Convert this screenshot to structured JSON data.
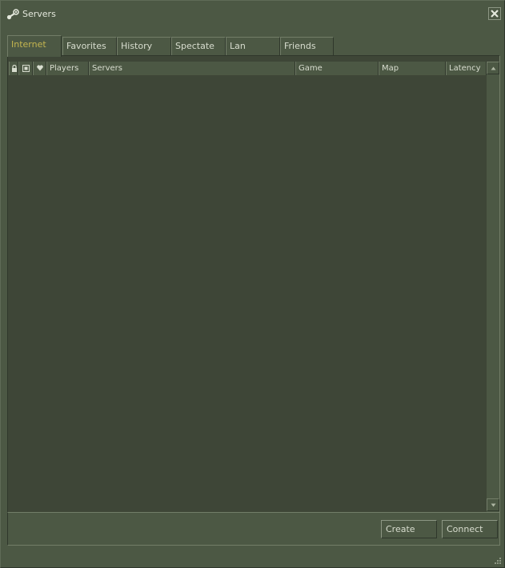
{
  "window": {
    "title": "Servers",
    "icon": "steam-icon",
    "close_icon": "close-icon"
  },
  "tabs": [
    {
      "label": "Internet",
      "active": true
    },
    {
      "label": "Favorites",
      "active": false
    },
    {
      "label": "History",
      "active": false
    },
    {
      "label": "Spectate",
      "active": false
    },
    {
      "label": "Lan",
      "active": false
    },
    {
      "label": "Friends",
      "active": false
    }
  ],
  "columns": {
    "password_icon": "lock-icon",
    "secure_icon": "vac-shield-icon",
    "bots_icon": "heart-icon",
    "players": "Players",
    "servers": "Servers",
    "game": "Game",
    "map": "Map",
    "latency": "Latency"
  },
  "buttons": {
    "create": "Create",
    "connect": "Connect"
  },
  "colors": {
    "panel": "#4c5844",
    "list_background": "#3e4637",
    "active_tab_text": "#c4b550",
    "text": "#d8ddcf"
  }
}
